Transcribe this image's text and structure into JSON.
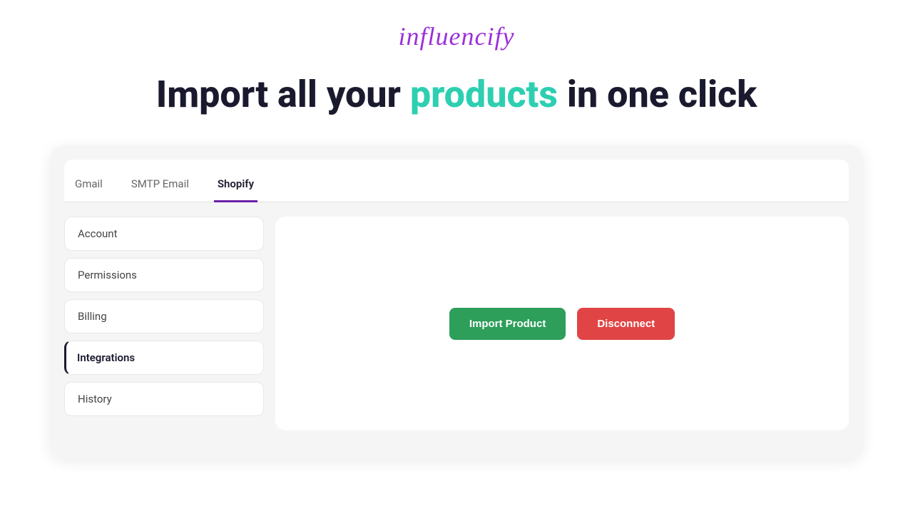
{
  "logo": {
    "text": "influencify"
  },
  "headline": {
    "prefix": "Import all your ",
    "highlight": "products",
    "suffix": " in one click"
  },
  "tabs": [
    {
      "id": "gmail",
      "label": "Gmail",
      "active": false
    },
    {
      "id": "smtp-email",
      "label": "SMTP Email",
      "active": false
    },
    {
      "id": "shopify",
      "label": "Shopify",
      "active": true
    }
  ],
  "sidebar": {
    "items": [
      {
        "id": "account",
        "label": "Account",
        "active": false
      },
      {
        "id": "permissions",
        "label": "Permissions",
        "active": false
      },
      {
        "id": "billing",
        "label": "Billing",
        "active": false
      },
      {
        "id": "integrations",
        "label": "Integrations",
        "active": true
      },
      {
        "id": "history",
        "label": "History",
        "active": false
      }
    ]
  },
  "main": {
    "import_button_label": "Import Product",
    "disconnect_button_label": "Disconnect"
  }
}
